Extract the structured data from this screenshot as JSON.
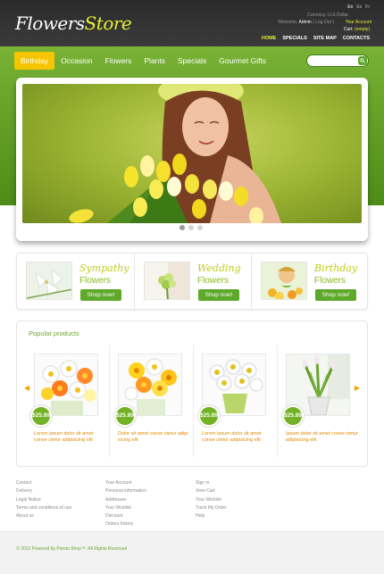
{
  "header": {
    "logo_part1": "Flowers",
    "logo_part2": "Store",
    "languages": [
      "En",
      "Es",
      "Fr"
    ],
    "currency_label": "Currency:",
    "currency_value": "U.S Dollar",
    "welcome": "Welcome,",
    "user_name": "Admin",
    "logout": "( Log Out )",
    "your_account": "Your Account",
    "cart_label": "Cart:",
    "cart_value": "(empty)",
    "nav": [
      "HOME",
      "SPECIALS",
      "SITE MAP",
      "CONTACTS"
    ]
  },
  "categories": [
    "Birthday",
    "Occasion",
    "Flowers",
    "Plants",
    "Specials",
    "Gourmet Gifts"
  ],
  "search": {
    "placeholder": ""
  },
  "slider": {
    "dots": 3,
    "active": 0
  },
  "promos": [
    {
      "title": "Sympathy",
      "subtitle": "Flowers",
      "button": "Shop now!"
    },
    {
      "title": "Wedding",
      "subtitle": "Flowers",
      "button": "Shop now!"
    },
    {
      "title": "Birthday",
      "subtitle": "Flowers",
      "button": "Shop now!"
    }
  ],
  "popular": {
    "title": "Popular products",
    "products": [
      {
        "price": "$25.89",
        "description": "Lorem ipsum dolor sit amet conse ctetur adipisicing elit"
      },
      {
        "price": "$25.89",
        "description": "Dolor sit amet conse ctetur adipi sicing elit"
      },
      {
        "price": "$25.89",
        "description": "Lorem ipsum dolor sit amet conse ctetur adipisicing elit"
      },
      {
        "price": "$25.89",
        "description": "Ipsum dolor sit amet conse ctetur adipisicing elit"
      }
    ]
  },
  "footer": {
    "col1": [
      "Contact",
      "Delivery",
      "Legal Notice",
      "Terms and conditions of use",
      "About us"
    ],
    "col2": [
      "Your Account",
      "Personal information",
      "Addresses",
      "Your Wishlist",
      "Discount",
      "Orders history"
    ],
    "col3": [
      "Sign in",
      "View Cart",
      "Your Wishlist",
      "Track My Order",
      "Help"
    ],
    "copyright": "© 2012 Powered by Presta Shop™. All Rights Reserved"
  }
}
